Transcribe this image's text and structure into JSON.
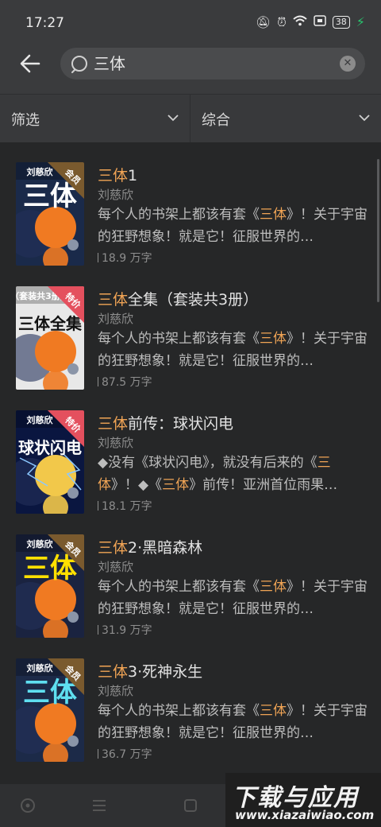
{
  "status": {
    "time": "17:27",
    "battery": "38"
  },
  "search": {
    "query": "三体"
  },
  "filters": {
    "left": "筛选",
    "right": "综合"
  },
  "books": [
    {
      "title_hl": "三体",
      "title_rest": "1",
      "author": "刘慈欣",
      "desc_parts": [
        [
          "每个人的书架上都该有套《",
          false
        ],
        [
          "三体",
          true
        ],
        [
          "》！关于宇宙的狂野想象！就是它！征服世界的…",
          false
        ]
      ],
      "words": "18.9 万字",
      "badge": "会员",
      "cover_title": "三体",
      "cover_author": "刘慈欣"
    },
    {
      "title_hl": "三体",
      "title_rest": "全集（套装共3册）",
      "author": "刘慈欣",
      "desc_parts": [
        [
          "每个人的书架上都该有套《",
          false
        ],
        [
          "三体",
          true
        ],
        [
          "》！关于宇宙的狂野想象！就是它！征服世界的…",
          false
        ]
      ],
      "words": "87.5 万字",
      "badge": "特价",
      "cover_title": "三体全集",
      "cover_author": "（套装共3册）"
    },
    {
      "title_hl": "三体",
      "title_rest": "前传：球状闪电",
      "author": "刘慈欣",
      "desc_parts": [
        [
          "◆没有《球状闪电》，就没有后来的《",
          false
        ],
        [
          "三体",
          true
        ],
        [
          "》！◆《",
          false
        ],
        [
          "三体",
          true
        ],
        [
          "》前传！亚洲首位雨果…",
          false
        ]
      ],
      "words": "18.1 万字",
      "badge": "特价",
      "cover_title": "球状闪电",
      "cover_author": "刘慈欣"
    },
    {
      "title_hl": "三体",
      "title_rest": "2·黑暗森林",
      "author": "刘慈欣",
      "desc_parts": [
        [
          "每个人的书架上都该有套《",
          false
        ],
        [
          "三体",
          true
        ],
        [
          "》！关于宇宙的狂野想象！就是它！征服世界的…",
          false
        ]
      ],
      "words": "31.9 万字",
      "badge": "会员",
      "cover_title": "三体",
      "cover_author": "刘慈欣"
    },
    {
      "title_hl": "三体",
      "title_rest": "3·死神永生",
      "author": "刘慈欣",
      "desc_parts": [
        [
          "每个人的书架上都该有套《",
          false
        ],
        [
          "三体",
          true
        ],
        [
          "》！关于宇宙的狂野想象！就是它！征服世界的…",
          false
        ]
      ],
      "words": "36.7 万字",
      "badge": "会员",
      "cover_title": "三体",
      "cover_author": "刘慈欣"
    }
  ],
  "watermark": {
    "cn": "下载与应用",
    "en": "www.xiazaiwiao.com"
  },
  "colors": {
    "highlight": "#f0a455",
    "member_badge": "#7a5a2e",
    "sale_badge": "#e4505e"
  }
}
